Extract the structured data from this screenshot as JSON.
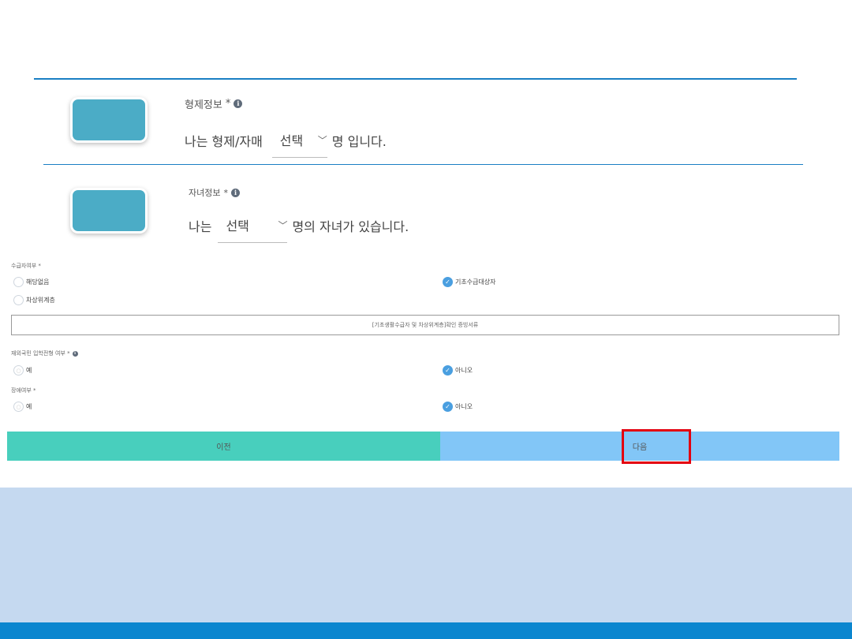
{
  "sibling": {
    "title": "형제정보",
    "required": "*",
    "prefix": "나는 형제/자매",
    "select_value": "선택",
    "suffix": "명 입니다."
  },
  "children": {
    "title": "자녀정보",
    "required": "*",
    "prefix": "나는",
    "select_value": "선택",
    "suffix": "명의 자녀가 있습니다."
  },
  "recipient": {
    "label": "수급자여부 *",
    "options": [
      {
        "label": "해당없음",
        "checked": false
      },
      {
        "label": "기초수급대상자",
        "checked": true
      },
      {
        "label": "차상위계층",
        "checked": false
      }
    ],
    "doc_text": "[기초생활수급자 및 차상위계층]확인 증빙서류"
  },
  "overseas": {
    "label": "재외국민 입학전형 여부 *",
    "options": [
      {
        "label": "예",
        "checked": false
      },
      {
        "label": "아니오",
        "checked": true
      }
    ]
  },
  "disability": {
    "label": "장애여부 *",
    "options": [
      {
        "label": "예",
        "checked": false
      },
      {
        "label": "아니오",
        "checked": true
      }
    ]
  },
  "buttons": {
    "prev": "이전",
    "next": "다음"
  },
  "icons": {
    "info": "info-icon",
    "chevron": "chevron-down-icon",
    "check": "check-icon"
  },
  "colors": {
    "accent_line": "#1a7fc4",
    "prev_button": "#48cfbd",
    "next_button": "#82c6f7",
    "highlight": "#e3000f",
    "band": "#c5d9f0",
    "footer_bar": "#0b86cf"
  }
}
